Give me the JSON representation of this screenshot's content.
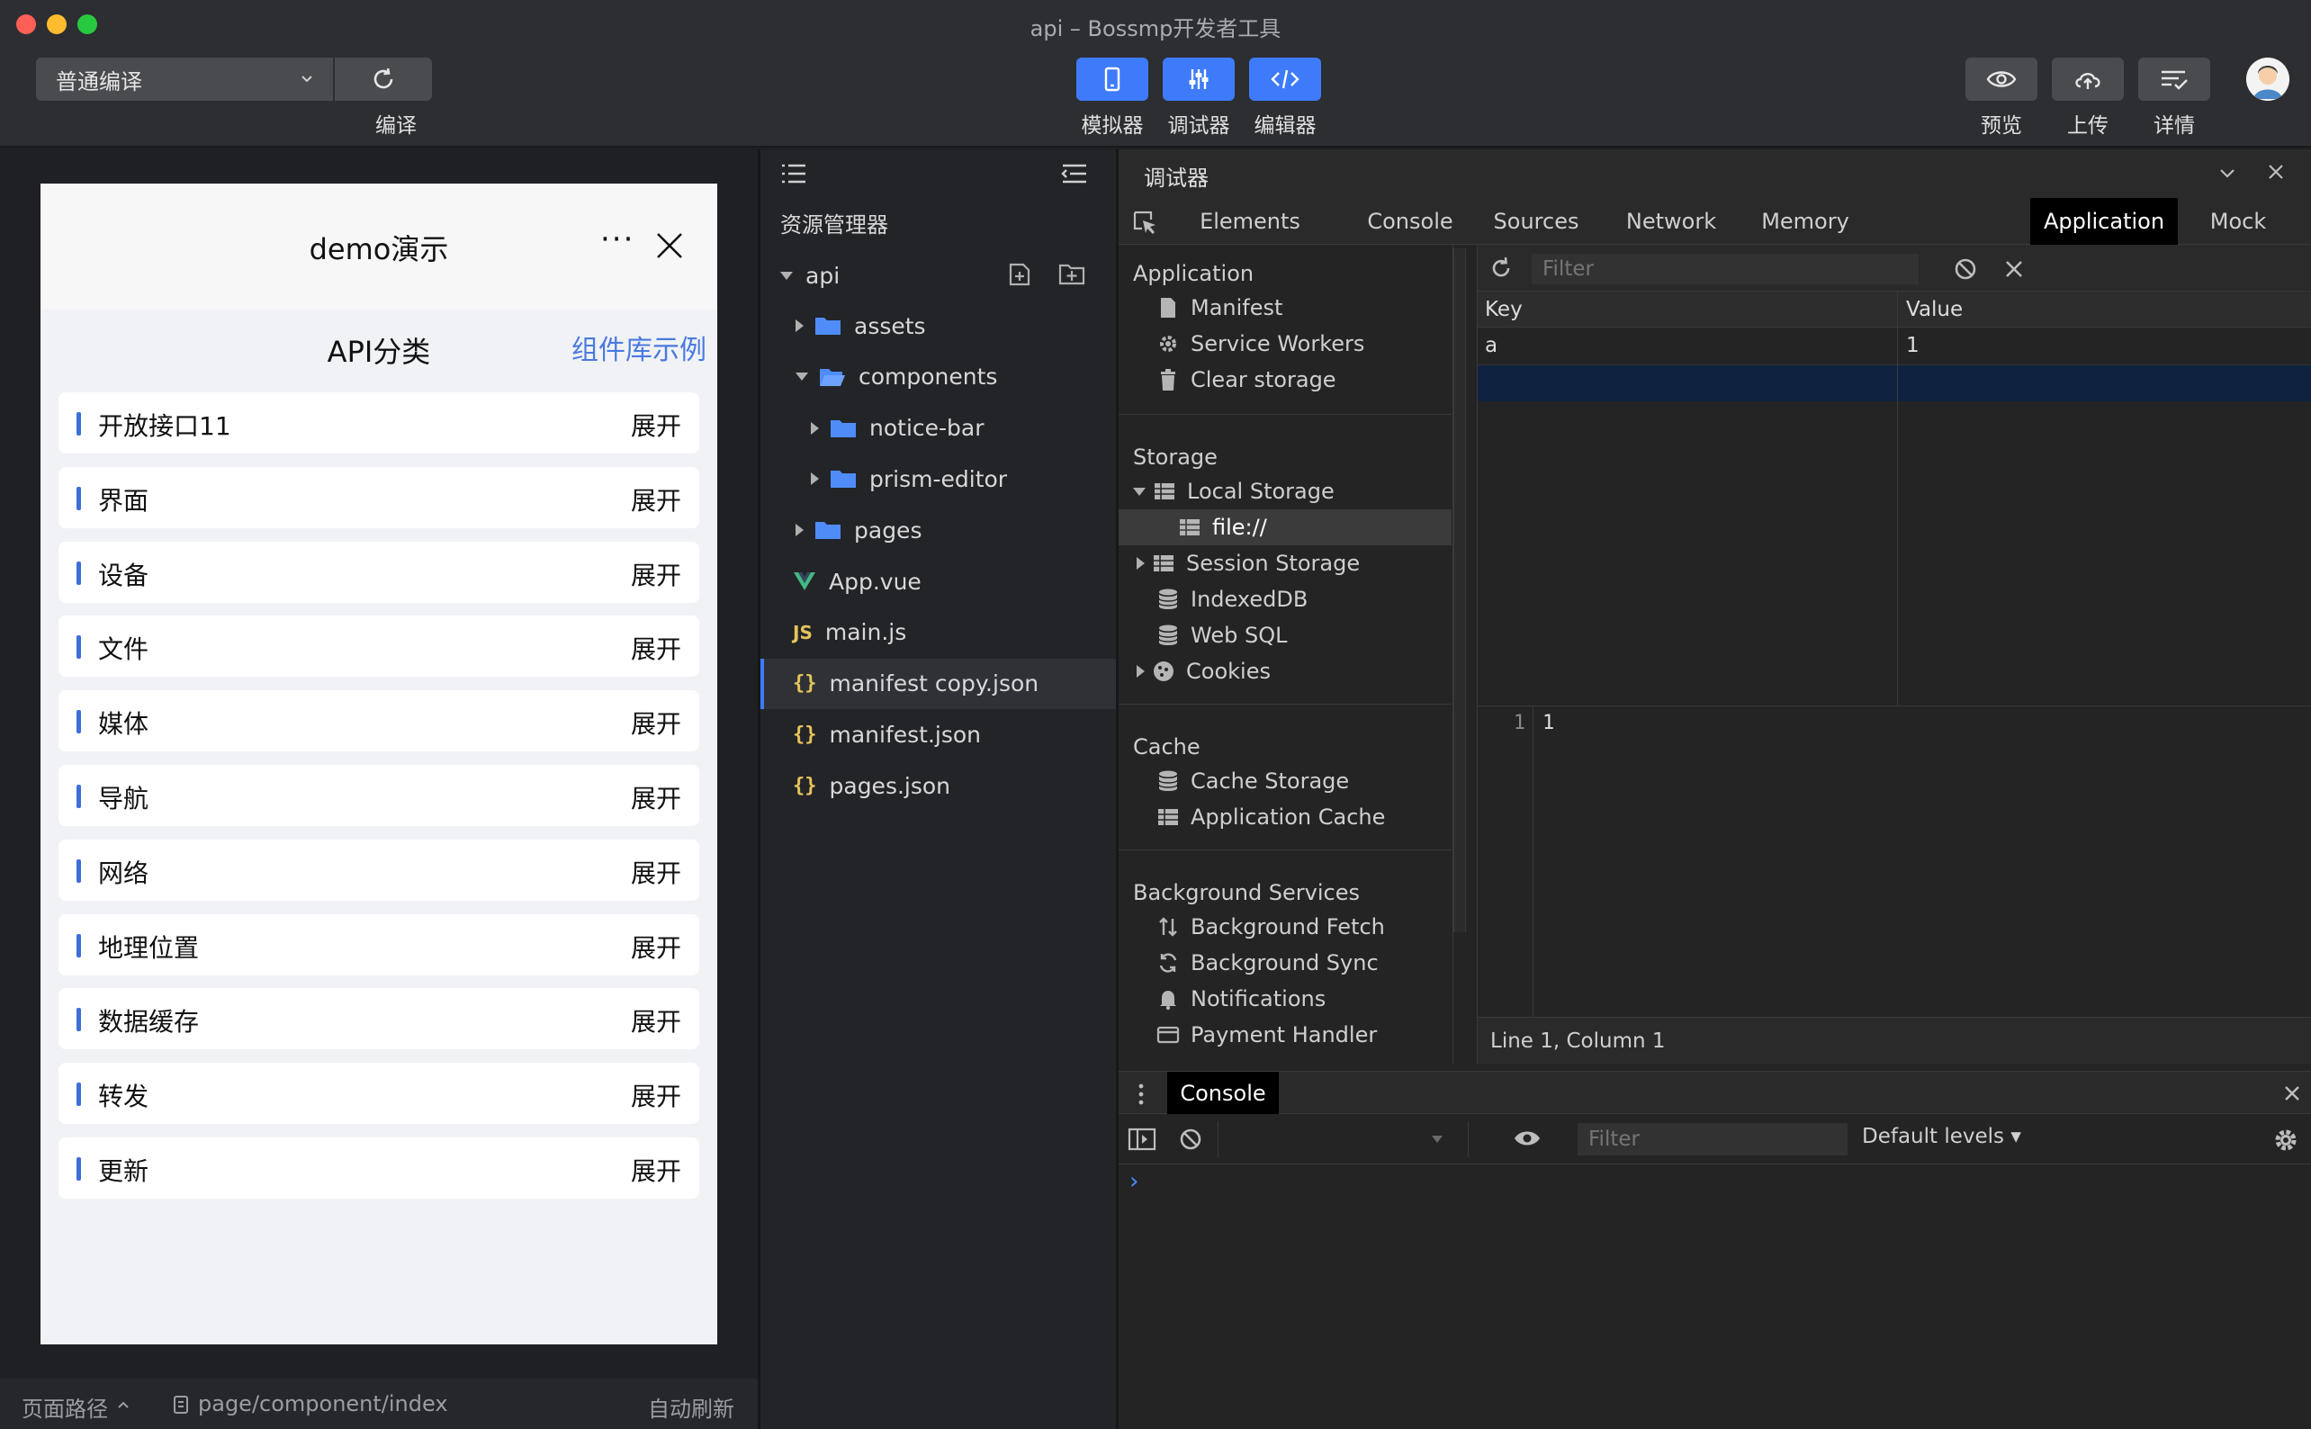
{
  "window": {
    "title": "api – Bossmp开发者工具"
  },
  "toolbar": {
    "compile_mode": "普通编译",
    "compile_label": "编译",
    "modes": [
      {
        "label": "模拟器",
        "icon": "phone-icon"
      },
      {
        "label": "调试器",
        "icon": "sliders-icon"
      },
      {
        "label": "编辑器",
        "icon": "code-icon"
      }
    ],
    "actions": [
      {
        "label": "预览",
        "icon": "eye-icon"
      },
      {
        "label": "上传",
        "icon": "cloud-upload-icon"
      },
      {
        "label": "详情",
        "icon": "details-icon"
      }
    ],
    "accent": "#3e7bfa"
  },
  "simulator": {
    "nav_title": "demo演示",
    "more": "···",
    "heading": "API分类",
    "link": "组件库示例",
    "expand_label": "展开",
    "items": [
      "开放接口11",
      "界面",
      "设备",
      "文件",
      "媒体",
      "导航",
      "网络",
      "地理位置",
      "数据缓存",
      "转发",
      "更新"
    ],
    "footer": {
      "path_label": "页面路径",
      "path": "page/component/index",
      "auto_refresh": "自动刷新"
    }
  },
  "explorer": {
    "title": "资源管理器",
    "root": "api",
    "items": [
      {
        "name": "assets",
        "type": "folder",
        "level": 1,
        "open": false
      },
      {
        "name": "components",
        "type": "folder",
        "level": 1,
        "open": true
      },
      {
        "name": "notice-bar",
        "type": "folder",
        "level": 2,
        "open": false
      },
      {
        "name": "prism-editor",
        "type": "folder",
        "level": 2,
        "open": false
      },
      {
        "name": "pages",
        "type": "folder",
        "level": 1,
        "open": false
      },
      {
        "name": "App.vue",
        "type": "vue",
        "level": 0
      },
      {
        "name": "main.js",
        "type": "js",
        "level": 0
      },
      {
        "name": "manifest copy.json",
        "type": "json",
        "level": 0,
        "selected": true
      },
      {
        "name": "manifest.json",
        "type": "json",
        "level": 0
      },
      {
        "name": "pages.json",
        "type": "json",
        "level": 0
      }
    ]
  },
  "debugger": {
    "title": "调试器",
    "tabs": [
      "Elements",
      "Console",
      "Sources",
      "Network",
      "Memory",
      "Application",
      "Mock"
    ],
    "active_tab": "Application",
    "sections": [
      {
        "title": "Application",
        "items": [
          "Manifest",
          "Service Workers",
          "Clear storage"
        ]
      },
      {
        "title": "Storage",
        "items": [
          "Local Storage",
          "file://",
          "Session Storage",
          "IndexedDB",
          "Web SQL",
          "Cookies"
        ]
      },
      {
        "title": "Cache",
        "items": [
          "Cache Storage",
          "Application Cache"
        ]
      },
      {
        "title": "Background Services",
        "items": [
          "Background Fetch",
          "Background Sync",
          "Notifications",
          "Payment Handler"
        ]
      }
    ],
    "filter_placeholder": "Filter",
    "columns": [
      "Key",
      "Value"
    ],
    "rows": [
      {
        "key": "a",
        "value": "1"
      }
    ],
    "preview": {
      "line_no": "1",
      "content": "1"
    },
    "status": "Line 1, Column 1"
  },
  "console": {
    "tab": "Console",
    "filter_placeholder": "Filter",
    "levels": "Default levels ▾",
    "prompt": "›"
  }
}
